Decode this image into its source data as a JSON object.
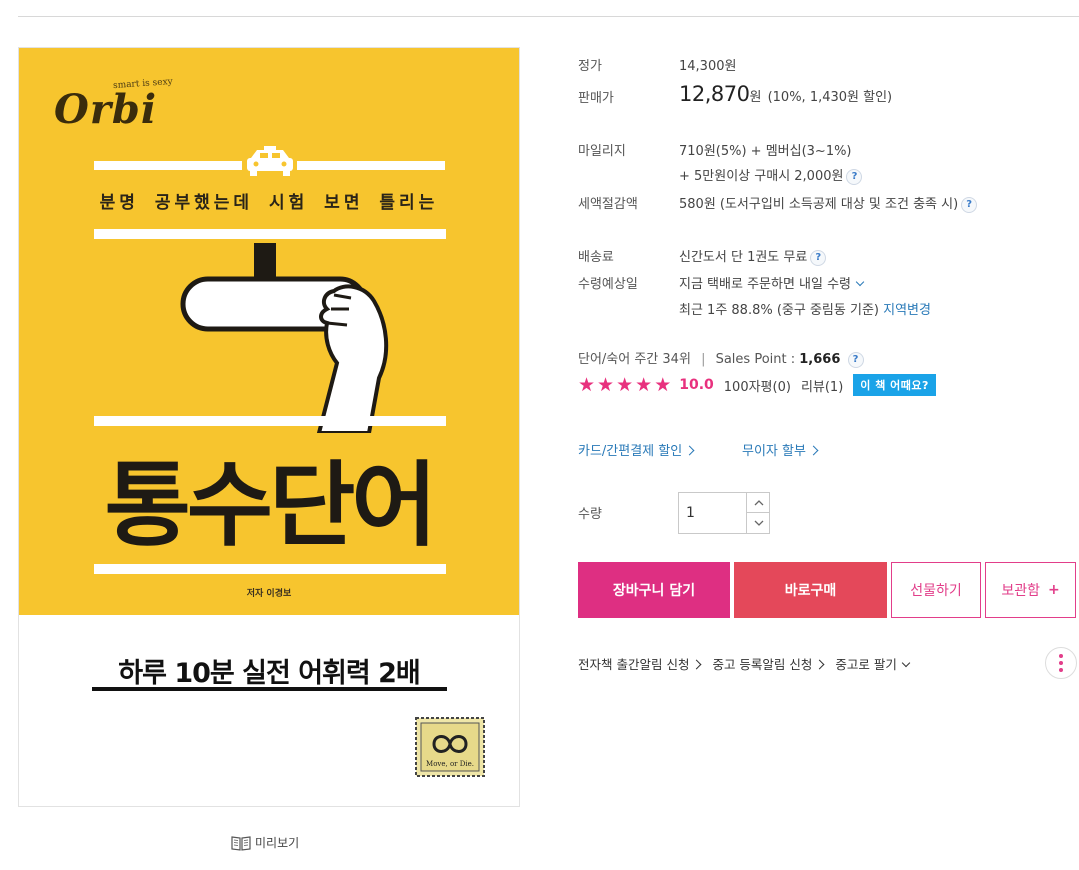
{
  "cover": {
    "brand_small": "smart is sexy",
    "brand_logo": "Orbi",
    "tagline": "분명 공부했는데 시험 보면 틀리는",
    "title": "통수단어",
    "author": "저자 이경보",
    "subtitle": "하루 10분 실전 어휘력 2배",
    "stamp_text": "Move, or Die."
  },
  "preview": {
    "label": "미리보기",
    "icon": "book-open-icon"
  },
  "price": {
    "list_label": "정가",
    "list_value": "14,300원",
    "sale_label": "판매가",
    "sale_amount": "12,870",
    "sale_unit": "원",
    "sale_note": "(10%, 1,430원 할인)"
  },
  "mileage": {
    "label": "마일리지",
    "line1": "710원(5%) + 멤버십(3~1%)",
    "line2": "+ 5만원이상 구매시 2,000원"
  },
  "tax": {
    "label": "세액절감액",
    "value": "580원 (도서구입비 소득공제 대상 및 조건 충족 시)"
  },
  "shipping": {
    "fee_label": "배송료",
    "fee_value": "신간도서 단 1권도 무료",
    "eta_label": "수령예상일",
    "eta_value": "지금 택배로 주문하면 내일 수령",
    "stat_value": "최근 1주 88.8% (중구 중림동 기준)",
    "region_link": "지역변경"
  },
  "rank": {
    "text": "단어/숙어 주간 34위",
    "separator": "|",
    "sales_label": "Sales Point :",
    "sales_value": "1,666"
  },
  "rating": {
    "stars": 5,
    "score": "10.0",
    "reviews_short": "100자평(0)",
    "reviews_long": "리뷰(1)",
    "badge": "이 책 어때요?"
  },
  "discounts": {
    "card": "카드/간편결제 할인",
    "installment": "무이자 할부"
  },
  "quantity": {
    "label": "수량",
    "value": "1"
  },
  "buttons": {
    "cart": "장바구니 담기",
    "buy": "바로구매",
    "gift": "선물하기",
    "keep": "보관함",
    "keep_plus": "+"
  },
  "links": {
    "ebook": "전자책 출간알림 신청",
    "used_alert": "중고 등록알림 신청",
    "used_sell": "중고로 팔기"
  },
  "colors": {
    "accent_pink": "#de2f82",
    "buy_red": "#e4485a",
    "cover_yellow": "#f7c52e",
    "link_blue": "#2a7ab8",
    "badge_blue": "#1aa3e8"
  }
}
